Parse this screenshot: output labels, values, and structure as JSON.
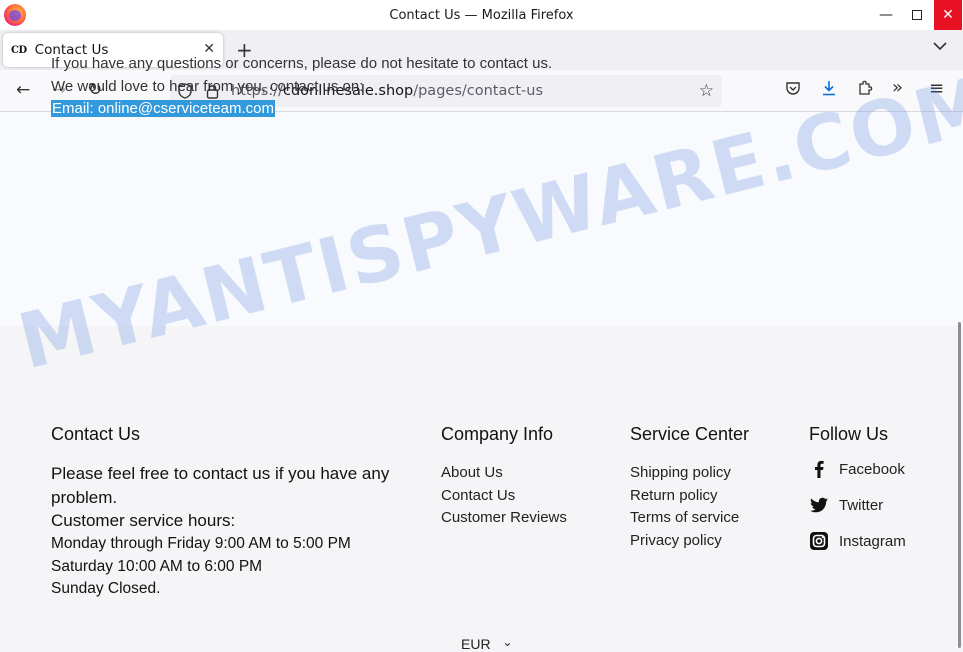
{
  "window": {
    "title": "Contact Us — Mozilla Firefox",
    "minimize": "—",
    "close": "✕"
  },
  "tabs": [
    {
      "favicon": "CD",
      "label": "Contact Us",
      "close": "✕"
    }
  ],
  "toolbar": {
    "new_tab": "+",
    "tab_list": "⌄",
    "back": "←",
    "forward": "→",
    "reload": "↻",
    "star": "☆",
    "extensions_overflow": "»",
    "menu": "≡"
  },
  "urlbar": {
    "scheme": "https://",
    "host": "cdonlinesale.shop",
    "path": "/pages/contact-us"
  },
  "content": {
    "line1": "If you have any questions or concerns, please do not hesitate to contact us.",
    "line2": "We would love to hear from you, contact us on:",
    "email": "Email: online@cserviceteam.com"
  },
  "watermark": "MYANTISPYWARE.COM",
  "footer": {
    "contact": {
      "heading": "Contact Us",
      "text1": "Please feel free to contact us if you have any problem.",
      "text2": "Customer service hours:",
      "hours": [
        "Monday through Friday 9:00 AM to 5:00 PM",
        "Saturday 10:00 AM to 6:00 PM",
        "Sunday Closed."
      ]
    },
    "company": {
      "heading": "Company Info",
      "links": [
        "About Us",
        "Contact Us",
        "Customer Reviews"
      ]
    },
    "service": {
      "heading": "Service Center",
      "links": [
        "Shipping policy",
        "Return policy",
        "Terms of service",
        "Privacy policy"
      ]
    },
    "follow": {
      "heading": "Follow Us",
      "links": [
        "Facebook",
        "Twitter",
        "Instagram"
      ]
    },
    "currency": "EUR",
    "currency_caret": "⌄"
  },
  "colors": {
    "email_highlight": "#3399dd",
    "close_button": "#e81123",
    "watermark": "#5a82dc"
  }
}
